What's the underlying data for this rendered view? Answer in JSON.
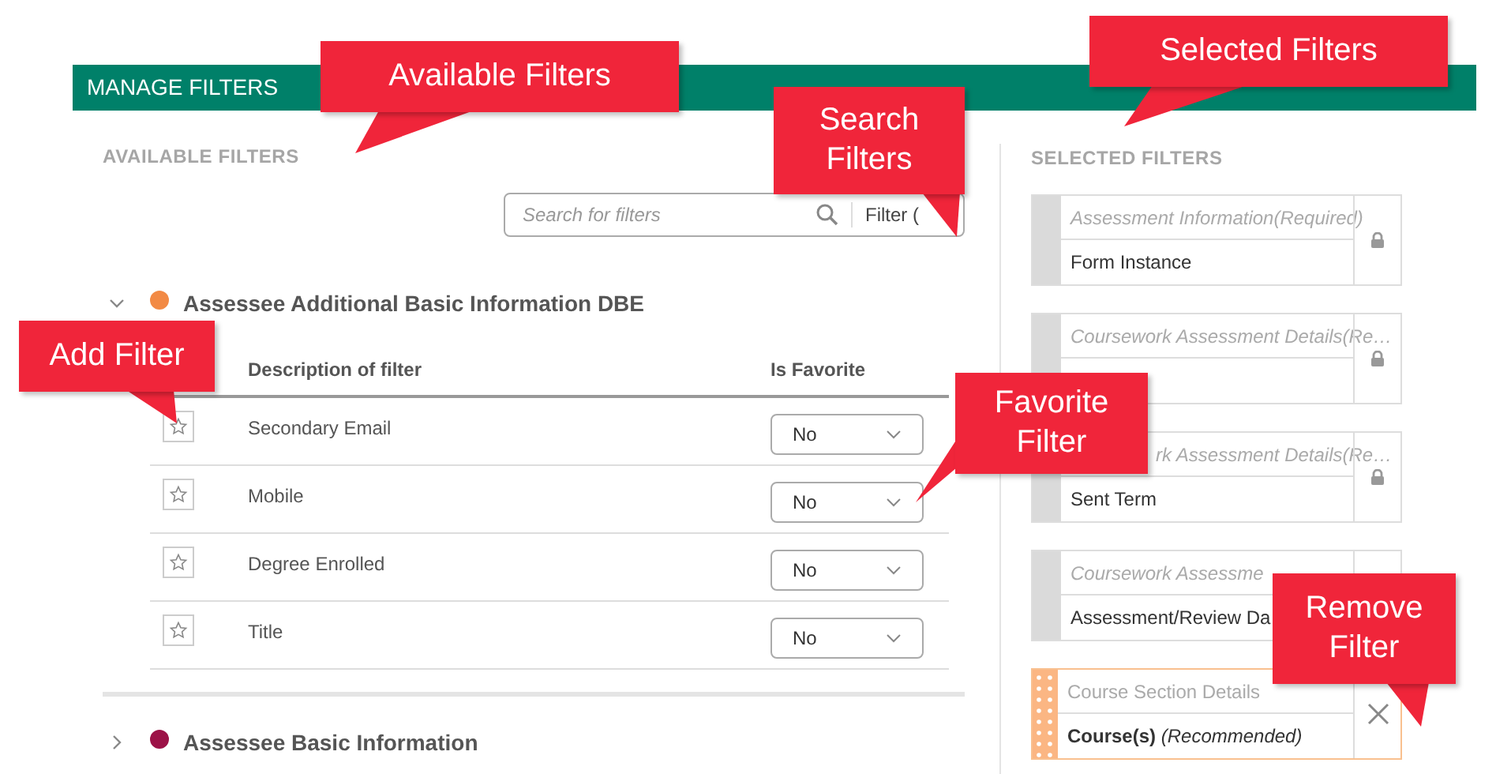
{
  "header": {
    "title": "MANAGE FILTERS"
  },
  "available": {
    "heading": "AVAILABLE FILTERS",
    "search": {
      "placeholder": "Search for filters"
    },
    "filter_button": "Filter (",
    "groups": [
      {
        "name": "Assessee Additional Basic Information DBE",
        "color": "#f28a45",
        "expanded": true,
        "columns": [
          "Description of filter",
          "Is Favorite"
        ],
        "rows": [
          {
            "name": "Secondary Email",
            "favorite": "No"
          },
          {
            "name": "Mobile",
            "favorite": "No"
          },
          {
            "name": "Degree Enrolled",
            "favorite": "No"
          },
          {
            "name": "Title",
            "favorite": "No"
          }
        ]
      },
      {
        "name": "Assessee Basic Information",
        "color": "#9c1247",
        "expanded": false
      }
    ]
  },
  "selected": {
    "heading": "SELECTED FILTERS",
    "cards": [
      {
        "kind": "locked",
        "category": "Assessment Information(Required)",
        "value": "Form Instance"
      },
      {
        "kind": "locked",
        "category": "Coursework Assessment Details(Re…"
      },
      {
        "kind": "locked",
        "category": "rk Assessment Details(Re…",
        "value": "Sent Term"
      },
      {
        "kind": "covered",
        "category": "Coursework Assessme",
        "value": "Assessment/Review Da"
      },
      {
        "kind": "removable",
        "category": "Course Section Details",
        "value": "**Course(s)** *(Recommended)*"
      }
    ]
  },
  "callouts": [
    "Available Filters",
    "Selected Filters",
    "Search Filters",
    "Add Filter",
    "Favorite Filter",
    "Remove Filter"
  ]
}
